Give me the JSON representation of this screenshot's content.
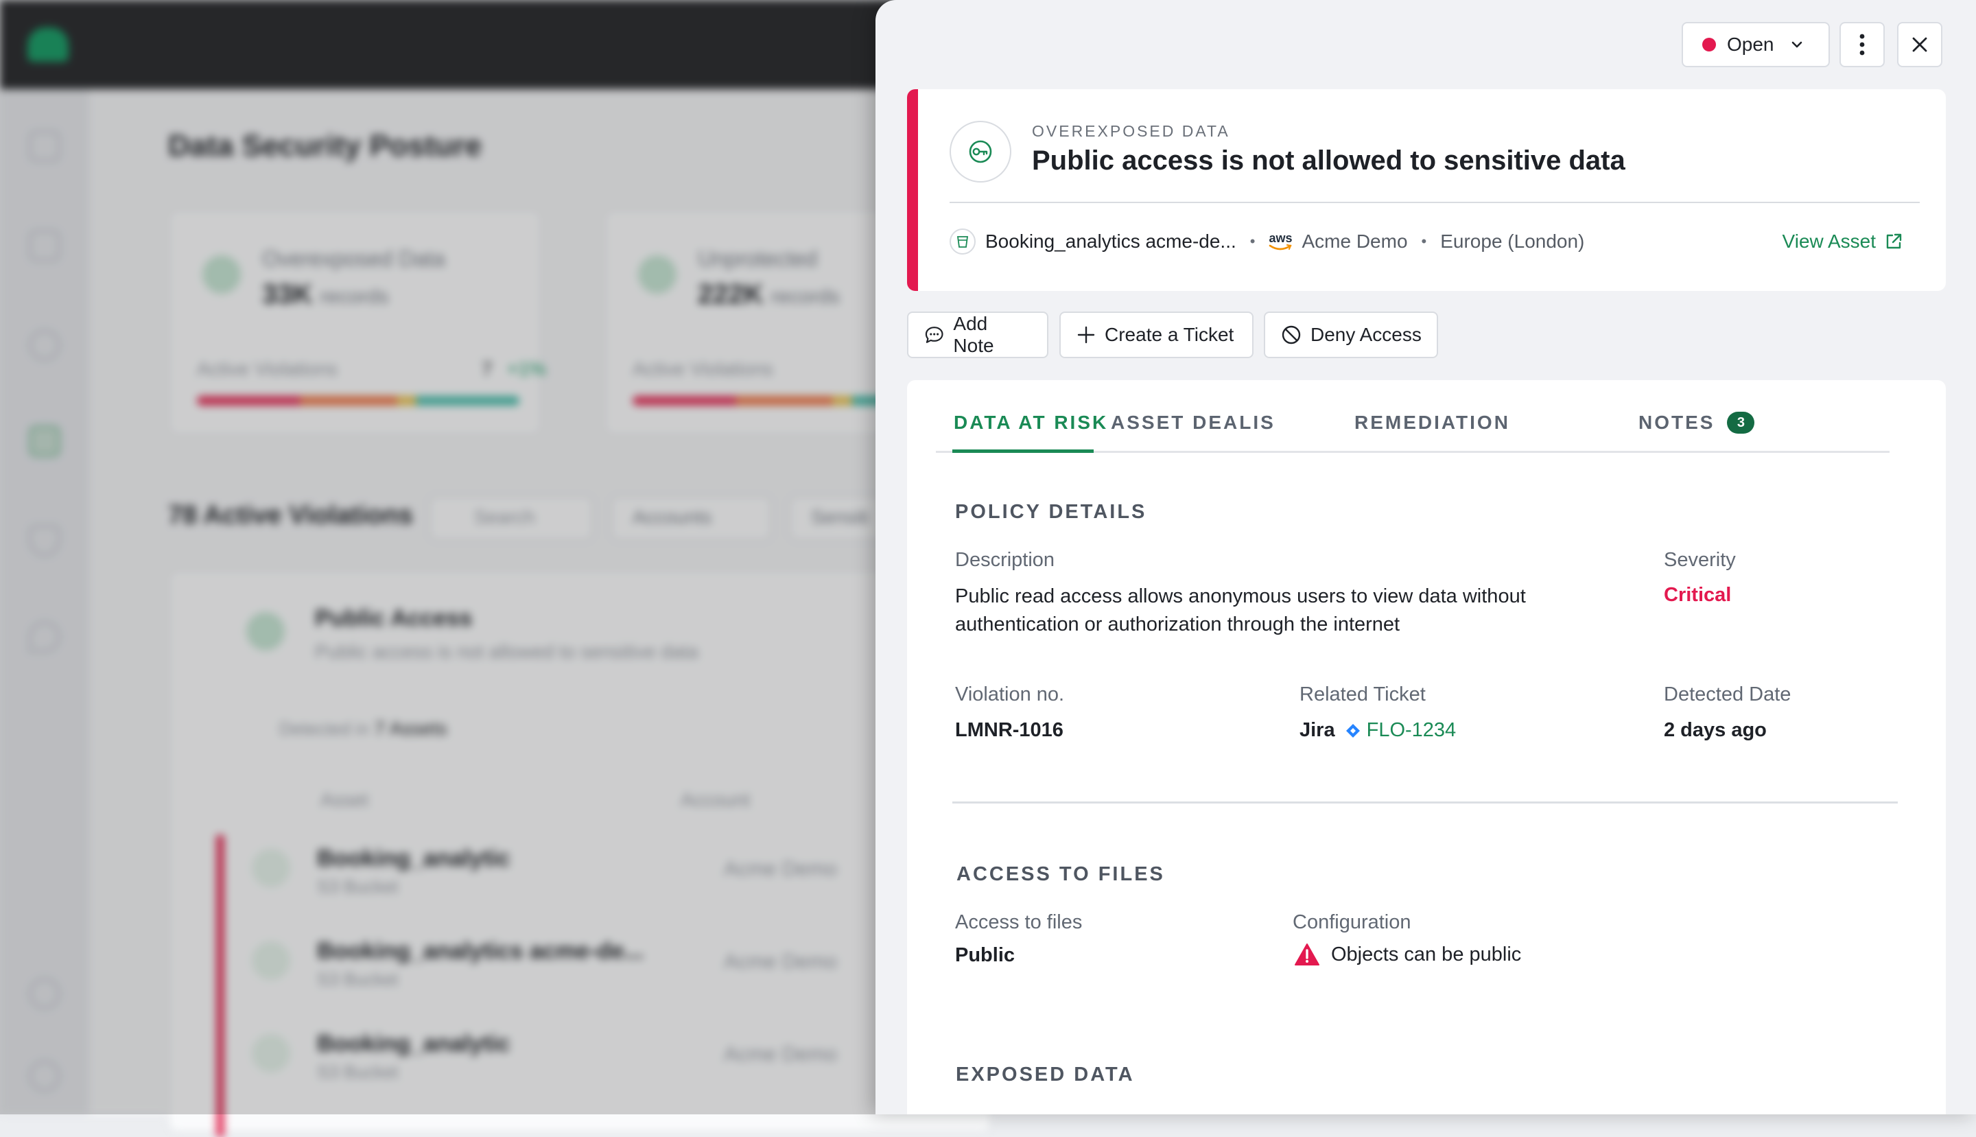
{
  "background": {
    "page_title": "Data Security Posture",
    "cards": [
      {
        "title": "Overexposed Data",
        "value": "33K",
        "unit": "records",
        "footer_label": "Active Violations",
        "footer_count": "7",
        "footer_delta": "+1%"
      },
      {
        "title": "Unprotected",
        "value": "222K",
        "unit": "records",
        "footer_label": "Active Violations"
      }
    ],
    "violations_title": "78 Active Violations",
    "search_placeholder": "Search",
    "filter_accounts": "Accounts",
    "filter_sensitivity": "Sensiti",
    "group_title": "Public Access",
    "group_subtitle": "Public access is not allowed to sensitive data",
    "group_detected": "Detected in",
    "group_assets": "7 Assets",
    "table_headers": [
      "Asset",
      "Account"
    ],
    "rows": [
      {
        "asset": "Booking_analytic",
        "type": "S3 Bucket",
        "account": "Acme Demo"
      },
      {
        "asset": "Booking_analytics acme-de...",
        "type": "S3 Bucket",
        "account": "Acme Demo"
      },
      {
        "asset": "Booking_analytic",
        "type": "S3 Bucket",
        "account": "Acme Demo"
      }
    ]
  },
  "panel": {
    "status": "Open",
    "category": "OVEREXPOSED DATA",
    "title": "Public access is not allowed to sensitive data",
    "asset": {
      "name": "Booking_analytics acme-de...",
      "provider": "aws",
      "account": "Acme Demo",
      "region": "Europe (London)",
      "view_link": "View Asset"
    },
    "actions": {
      "add_note": "Add Note",
      "create_ticket": "Create a Ticket",
      "deny_access": "Deny Access"
    },
    "tabs": [
      {
        "label": "DATA AT RISK"
      },
      {
        "label": "ASSET DEALIS"
      },
      {
        "label": "REMEDIATION"
      },
      {
        "label": "NOTES",
        "badge": "3"
      }
    ],
    "policy": {
      "section_title": "POLICY DETAILS",
      "description_label": "Description",
      "description": "Public read access allows anonymous users to view data without authentication or authorization through the internet",
      "severity_label": "Severity",
      "severity": "Critical",
      "violation_label": "Violation no.",
      "violation": "LMNR-1016",
      "ticket_label": "Related Ticket",
      "ticket_system": "Jira",
      "ticket_id": "FLO-1234",
      "detected_label": "Detected Date",
      "detected": "2 days ago"
    },
    "access": {
      "section_title": "ACCESS TO FILES",
      "access_label": "Access to files",
      "access_value": "Public",
      "config_label": "Configuration",
      "config_value": "Objects can be public"
    },
    "exposed": {
      "section_title": "EXPOSED DATA"
    }
  },
  "colors": {
    "accent_green": "#1a8a55",
    "critical_red": "#e3194f",
    "jira_blue": "#2684ff"
  }
}
